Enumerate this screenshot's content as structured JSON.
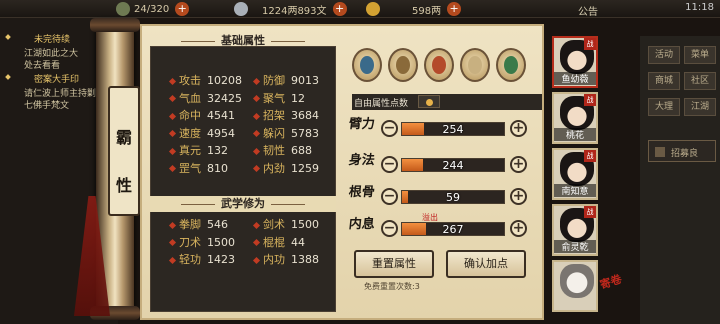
{
  "topbar": {
    "res1": "24/320",
    "silver": "1224两893文",
    "gold": "598两",
    "notice": "公告",
    "clock": "11:18"
  },
  "quest": {
    "title1": "未完待续",
    "line1": "江湖如此之大",
    "line2": "处去看看",
    "title2": "密案大手印",
    "line3": "请仁波上师主持剿",
    "line4": "七佛手梵文"
  },
  "tag": {
    "char1": "霸",
    "char2": "性"
  },
  "basic": {
    "title": "基础属性",
    "stats": [
      {
        "name": "攻击",
        "value": "10208"
      },
      {
        "name": "防御",
        "value": "9013"
      },
      {
        "name": "气血",
        "value": "32425"
      },
      {
        "name": "聚气",
        "value": "12"
      },
      {
        "name": "命中",
        "value": "4541"
      },
      {
        "name": "招架",
        "value": "3684"
      },
      {
        "name": "速度",
        "value": "4954"
      },
      {
        "name": "躲闪",
        "value": "5783"
      },
      {
        "name": "真元",
        "value": "132"
      },
      {
        "name": "韧性",
        "value": "688"
      },
      {
        "name": "罡气",
        "value": "810"
      },
      {
        "name": "内劲",
        "value": "1259"
      }
    ]
  },
  "martial": {
    "title": "武学修为",
    "stats": [
      {
        "name": "拳脚",
        "value": "546"
      },
      {
        "name": "剑术",
        "value": "1500"
      },
      {
        "name": "刀术",
        "value": "1500"
      },
      {
        "name": "棍棍",
        "value": "44"
      },
      {
        "name": "轻功",
        "value": "1423"
      },
      {
        "name": "内功",
        "value": "1388"
      }
    ]
  },
  "free_points": {
    "label": "自由属性点数"
  },
  "attributes": [
    {
      "label": "臂力",
      "value": "254",
      "fill": 0.22
    },
    {
      "label": "身法",
      "value": "244",
      "fill": 0.21
    },
    {
      "label": "根骨",
      "value": "59",
      "fill": 0.06
    },
    {
      "label": "内息",
      "value": "267",
      "fill": 0.24
    }
  ],
  "overflow": "溢出",
  "buttons": {
    "reset": "重置属性",
    "confirm": "确认加点"
  },
  "reset_note": "免费重置次数:3",
  "characters": [
    {
      "name": "鱼幼薇",
      "tag": "战"
    },
    {
      "name": "桃花",
      "tag": "战"
    },
    {
      "name": "南知意",
      "tag": "战"
    },
    {
      "name": "俞灵乾",
      "tag": "战"
    }
  ],
  "rmenu": {
    "b1": "活动",
    "b2": "菜单",
    "b3": "商城",
    "b4": "社区",
    "b5": "大理",
    "b6": "江湖",
    "box": "招募良"
  },
  "stamp": "寄卷"
}
